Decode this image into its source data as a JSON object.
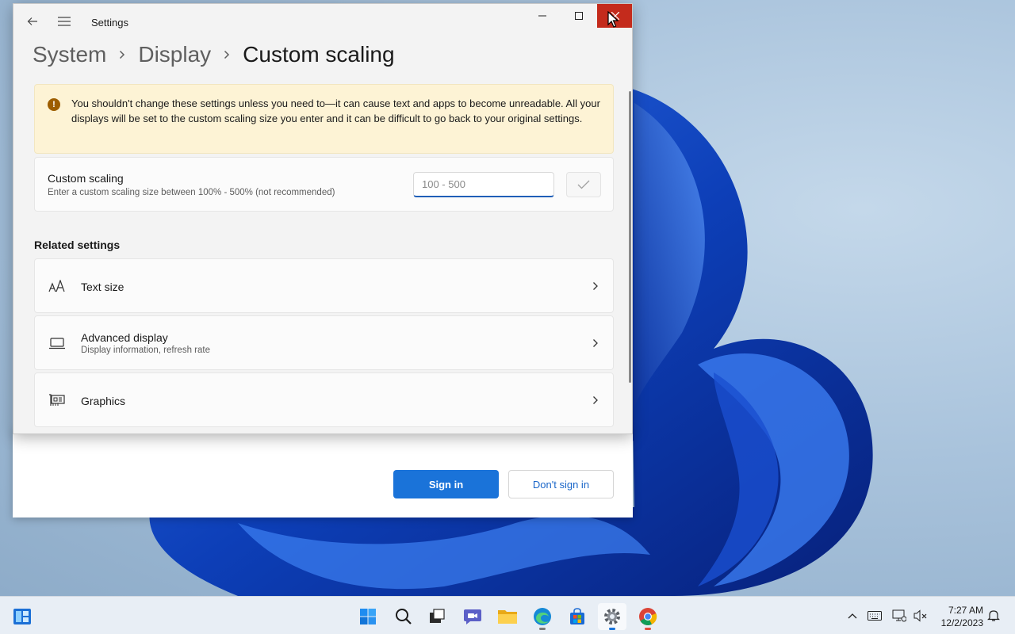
{
  "window": {
    "app_title": "Settings",
    "back_icon": "back-arrow-icon",
    "menu_icon": "hamburger-menu-icon",
    "controls": {
      "minimize": "minimize-icon",
      "maximize": "maximize-icon",
      "close": "close-icon"
    }
  },
  "breadcrumb": [
    "System",
    "Display",
    "Custom scaling"
  ],
  "warning": {
    "icon": "warning-icon",
    "text": "You shouldn't change these settings unless you need to—it can cause text and apps to become unreadable. All your displays will be set to the custom scaling size you enter and it can be difficult to go back to your original settings."
  },
  "custom_scaling": {
    "title": "Custom scaling",
    "description": "Enter a custom scaling size between 100% - 500% (not recommended)",
    "input_value": "",
    "input_placeholder": "100 - 500",
    "apply_icon": "checkmark-icon"
  },
  "related": {
    "heading": "Related settings",
    "items": [
      {
        "label": "Text size",
        "sub": "",
        "icon": "text-size-icon"
      },
      {
        "label": "Advanced display",
        "sub": "Display information, refresh rate",
        "icon": "monitor-icon"
      },
      {
        "label": "Graphics",
        "sub": "",
        "icon": "graphics-card-icon"
      }
    ]
  },
  "signin_dialog": {
    "primary_label": "Sign in",
    "secondary_label": "Don't sign in"
  },
  "taskbar": {
    "apps": [
      "widgets",
      "start",
      "search",
      "task-view",
      "chat",
      "file-explorer",
      "edge",
      "store",
      "settings",
      "chrome"
    ],
    "clock_time": "7:27 AM",
    "clock_date": "12/2/2023"
  },
  "colors": {
    "accent": "#1a73d9",
    "close_hover": "#c42b1c",
    "warning_bg": "#fdf3d5"
  }
}
